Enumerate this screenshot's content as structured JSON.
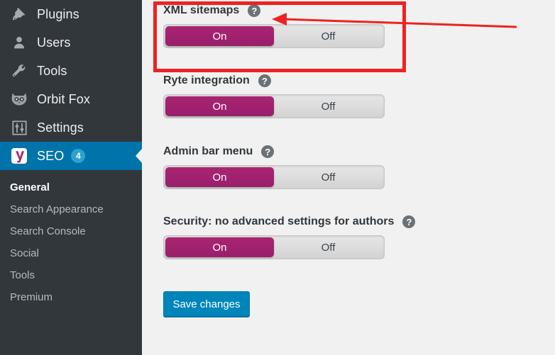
{
  "sidebar": {
    "items": [
      {
        "label": "Plugins",
        "icon": "plugin-icon",
        "current": false
      },
      {
        "label": "Users",
        "icon": "user-icon",
        "current": false
      },
      {
        "label": "Tools",
        "icon": "wrench-icon",
        "current": false
      },
      {
        "label": "Orbit Fox",
        "icon": "fox-icon",
        "current": false
      },
      {
        "label": "Settings",
        "icon": "sliders-icon",
        "current": false
      },
      {
        "label": "SEO",
        "icon": "yoast-icon",
        "current": true,
        "badge": "4"
      }
    ],
    "submenu": [
      {
        "label": "General",
        "active": true
      },
      {
        "label": "Search Appearance",
        "active": false
      },
      {
        "label": "Search Console",
        "active": false
      },
      {
        "label": "Social",
        "active": false
      },
      {
        "label": "Tools",
        "active": false
      },
      {
        "label": "Premium",
        "active": false
      }
    ]
  },
  "main": {
    "settings": [
      {
        "title": "XML sitemaps",
        "help": "?",
        "options": [
          "On",
          "Off"
        ],
        "selected": "On",
        "highlighted": true
      },
      {
        "title": "Ryte integration",
        "help": "?",
        "options": [
          "On",
          "Off"
        ],
        "selected": "On",
        "highlighted": false
      },
      {
        "title": "Admin bar menu",
        "help": "?",
        "options": [
          "On",
          "Off"
        ],
        "selected": "On",
        "highlighted": false
      },
      {
        "title": "Security: no advanced settings for authors",
        "help": "?",
        "options": [
          "On",
          "Off"
        ],
        "selected": "On",
        "highlighted": false
      }
    ],
    "save_label": "Save changes"
  },
  "colors": {
    "sidebar_bg": "#32373c",
    "sidebar_current": "#0073aa",
    "badge": "#2ea2cc",
    "toggle_on": "#a02070",
    "toggle_off": "#dcdcdc",
    "save_button": "#0085ba",
    "annotation": "#ee2222",
    "page_bg": "#f1f1f1"
  },
  "annotation": {
    "shape": "rectangle-and-arrow",
    "arrow_points_to": "XML sitemaps"
  }
}
